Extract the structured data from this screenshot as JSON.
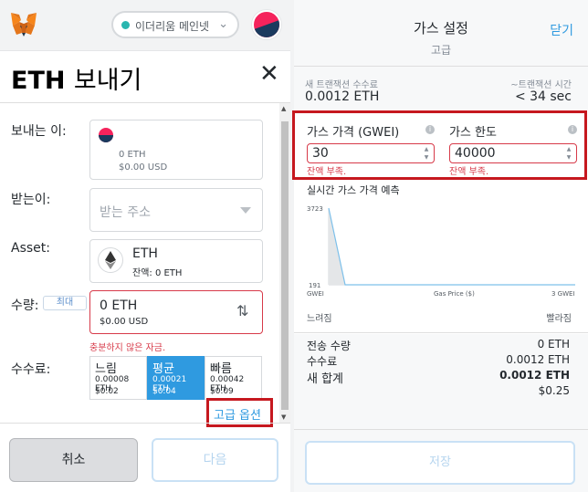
{
  "header": {
    "network": "이더리움 메인넷"
  },
  "send": {
    "title_eth": "ETH",
    "title_kor": "보내기",
    "close": "✕",
    "from_label": "보내는 이:",
    "from_eth": "0 ETH",
    "from_usd": "$0.00 USD",
    "to_label": "받는이:",
    "to_placeholder": "받는 주소",
    "asset_label": "Asset:",
    "asset_name": "ETH",
    "asset_balance": "잔액: 0 ETH",
    "amount_label": "수량:",
    "max_label": "최대",
    "amount_value": "0  ETH",
    "amount_usd": "$0.00 USD",
    "swap_icon": "⇅",
    "amount_error": "충분하지 않은 자금.",
    "fee_label": "수수료:",
    "fees": [
      {
        "name": "느림",
        "eth": "0.00008 ETH",
        "usd": "$0.02"
      },
      {
        "name": "평균",
        "eth": "0.00021 ETH",
        "usd": "$0.04"
      },
      {
        "name": "빠름",
        "eth": "0.00042 ETH",
        "usd": "$0.09"
      }
    ],
    "advanced_link": "고급 옵션",
    "cancel": "취소",
    "next": "다음"
  },
  "gas": {
    "title": "가스 설정",
    "subtitle": "고급",
    "close": "닫기",
    "new_fee_label": "새 트랜잭션 수수료",
    "new_fee_value": "0.0012 ETH",
    "time_label": "~트랜잭션 시간",
    "time_value": "< 34 sec",
    "price_label": "가스 가격 (GWEI)",
    "price_value": "30",
    "price_error": "잔액 부족.",
    "limit_label": "가스 한도",
    "limit_value": "40000",
    "limit_error": "잔액 부족.",
    "info_icon": "i",
    "chart_title": "실시간 가스 가격 예측",
    "slow": "느려짐",
    "fast": "빨라짐",
    "send_amount_label": "전송 수량",
    "send_amount_value": "0 ETH",
    "fee_label": "수수료",
    "fee_value": "0.0012 ETH",
    "total_label": "새 합계",
    "total_value": "0.0012 ETH",
    "total_usd": "$0.25",
    "save": "저장"
  },
  "chart_data": {
    "type": "area",
    "title": "실시간 가스 가격 예측",
    "xlabel": "Gas Price ($)",
    "x_tick_labels": [
      "GWEI",
      "3 GWEI"
    ],
    "y_tick_labels": [
      "3723",
      "191"
    ],
    "x": [
      0,
      0.2,
      3
    ],
    "y": [
      3723,
      191,
      191
    ],
    "ylim": [
      191,
      3723
    ],
    "colors": {
      "line": "#7dc0ea",
      "fill": "#e4e6e8"
    }
  }
}
